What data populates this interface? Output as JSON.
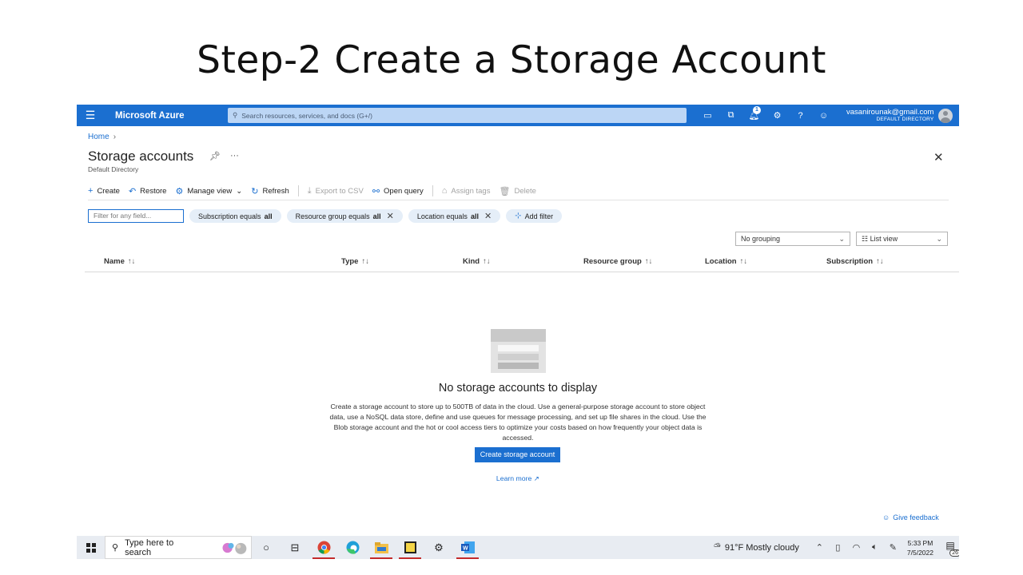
{
  "slide_title": "Step-2 Create a Storage Account",
  "azure": {
    "brand": "Microsoft Azure",
    "search_placeholder": "Search resources, services, and docs (G+/)",
    "notification_count": "1",
    "account_email": "vasanirounak@gmail.com",
    "account_directory": "DEFAULT DIRECTORY"
  },
  "breadcrumb": {
    "home": "Home",
    "separator": "›"
  },
  "page": {
    "title": "Storage accounts",
    "subtitle": "Default Directory",
    "more": "···"
  },
  "toolbar": {
    "create": "Create",
    "restore": "Restore",
    "manage_view": "Manage view",
    "refresh": "Refresh",
    "export_csv": "Export to CSV",
    "open_query": "Open query",
    "assign_tags": "Assign tags",
    "delete": "Delete"
  },
  "filters": {
    "placeholder": "Filter for any field...",
    "pills": [
      {
        "prefix": "Subscription equals ",
        "value": "all"
      },
      {
        "prefix": "Resource group equals ",
        "value": "all"
      },
      {
        "prefix": "Location equals ",
        "value": "all"
      }
    ],
    "add_filter": "Add filter"
  },
  "view_controls": {
    "grouping": "No grouping",
    "view": "List view"
  },
  "columns": [
    "Name",
    "Type",
    "Kind",
    "Resource group",
    "Location",
    "Subscription"
  ],
  "empty_state": {
    "title": "No storage accounts to display",
    "description": "Create a storage account to store up to 500TB of data in the cloud. Use a general-purpose storage account to store object data, use a NoSQL data store, define and use queues for message processing, and set up file shares in the cloud. Use the Blob storage account and the hot or cool access tiers to optimize your costs based on how frequently your object data is accessed.",
    "create_button": "Create storage account",
    "learn_more": "Learn more"
  },
  "feedback": "Give feedback",
  "taskbar": {
    "search_placeholder": "Type here to search",
    "weather": "91°F  Mostly cloudy",
    "time": "5:33 PM",
    "date": "7/5/2022",
    "notification_count": "26"
  },
  "colors": {
    "azure_blue": "#1b6fd0",
    "pill_bg": "#e5eef8",
    "taskbar_bg": "#e8ecf2"
  }
}
